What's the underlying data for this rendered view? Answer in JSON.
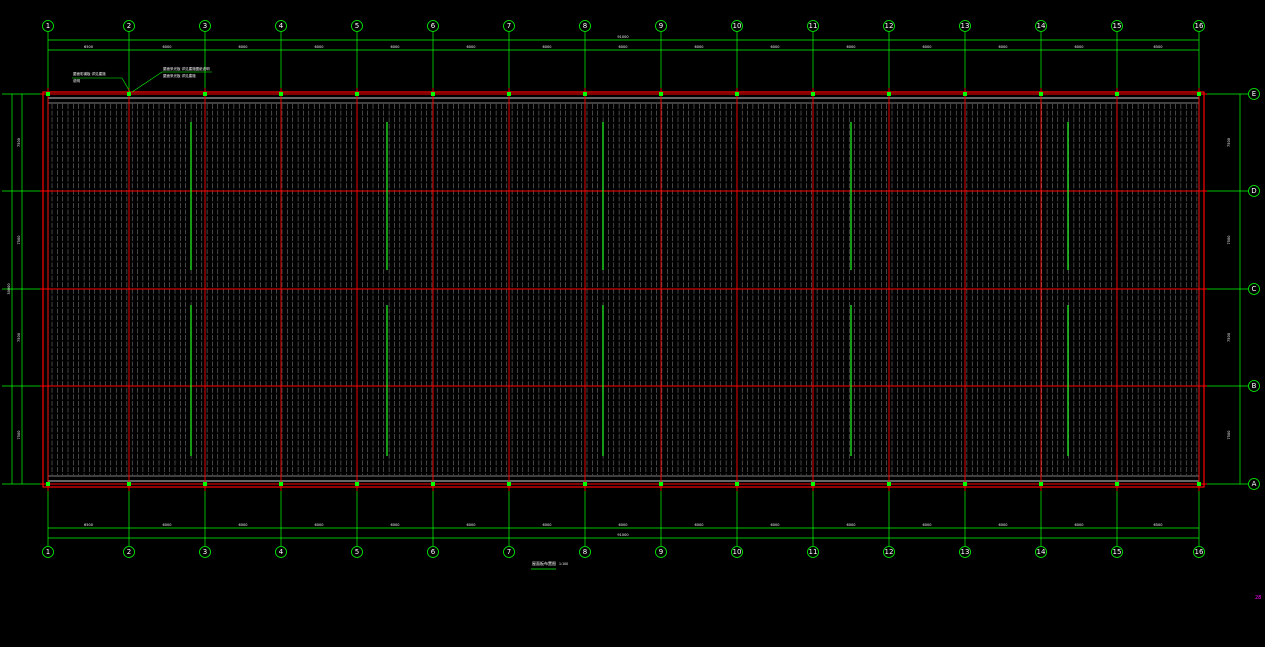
{
  "colors": {
    "background": "#000000",
    "axis_line": "#00ff00",
    "structural_line": "#ff0000",
    "panel_outline": "#ffffff",
    "panel_seam": "#9a9a9a",
    "purlin": "#22ee22",
    "text": "#ffffff",
    "stray_text": "#ff00ff"
  },
  "column_axes": [
    "1",
    "2",
    "3",
    "4",
    "5",
    "6",
    "7",
    "8",
    "9",
    "10",
    "11",
    "12",
    "13",
    "14",
    "15",
    "16"
  ],
  "row_axes": [
    "E",
    "D",
    "C",
    "B",
    "A"
  ],
  "dimensions": {
    "top_bay_spans": [
      "6500",
      "6000",
      "6000",
      "6000",
      "6000",
      "6000",
      "6000",
      "6000",
      "6000",
      "6000",
      "6000",
      "6000",
      "6000",
      "6000",
      "6500"
    ],
    "top_overall": "91000",
    "bottom_bay_spans": [
      "6500",
      "6000",
      "6000",
      "6000",
      "6000",
      "6000",
      "6000",
      "6000",
      "6000",
      "6000",
      "6000",
      "6000",
      "6000",
      "6000",
      "6500"
    ],
    "bottom_overall": "91000",
    "left_row_spans": [
      "7500",
      "7500",
      "7500",
      "7500"
    ],
    "left_overall": "30000",
    "right_row_spans": [
      "7500",
      "7500",
      "7500",
      "7500"
    ]
  },
  "notes": {
    "left_note_line1": "屋面彩钢板 详见建施",
    "left_note_line2": "说明",
    "right_note_line1": "屋面采光板 详见建施图纸说明",
    "right_note_line2": "屋面采光板 详见建施"
  },
  "plan_title": "屋面板布置图",
  "plan_scale": "1:100",
  "stray_text": "28"
}
